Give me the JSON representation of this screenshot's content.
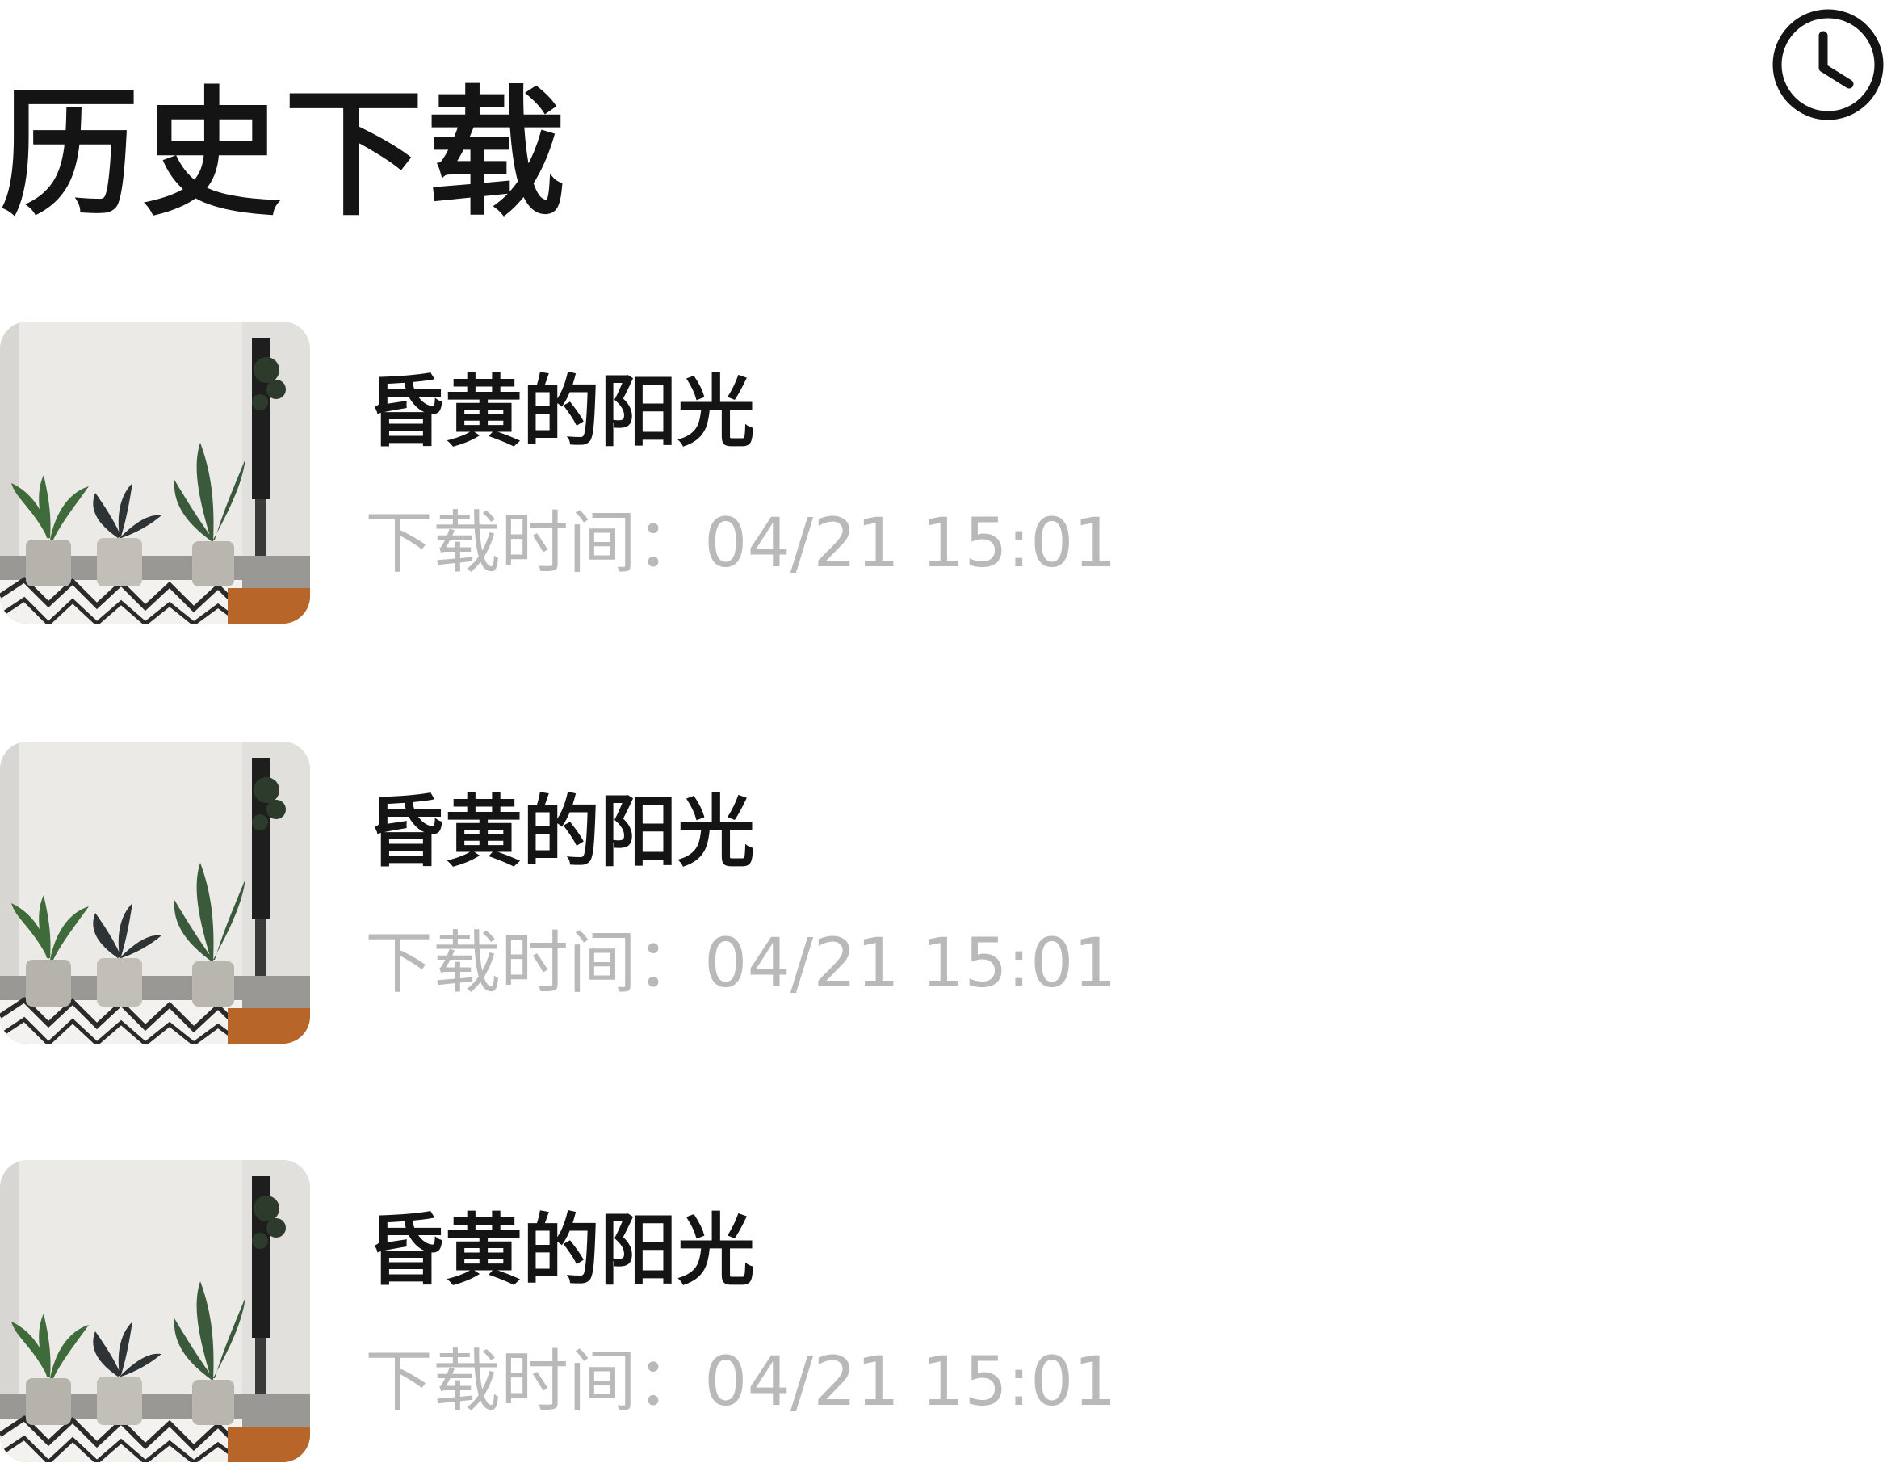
{
  "header": {
    "title": "历史下载",
    "history_icon": "clock-icon"
  },
  "downloads": [
    {
      "title": "昏黄的阳光",
      "time_label": "下载时间：",
      "time": "04/21 15:01",
      "thumbnail": "potted-plants-room-photo"
    },
    {
      "title": "昏黄的阳光",
      "time_label": "下载时间：",
      "time": "04/21 15:01",
      "thumbnail": "potted-plants-room-photo"
    },
    {
      "title": "昏黄的阳光",
      "time_label": "下载时间：",
      "time": "04/21 15:01",
      "thumbnail": "potted-plants-room-photo"
    }
  ],
  "colors": {
    "text_primary": "#141414",
    "text_secondary": "#b9b9b9",
    "background": "#ffffff"
  }
}
